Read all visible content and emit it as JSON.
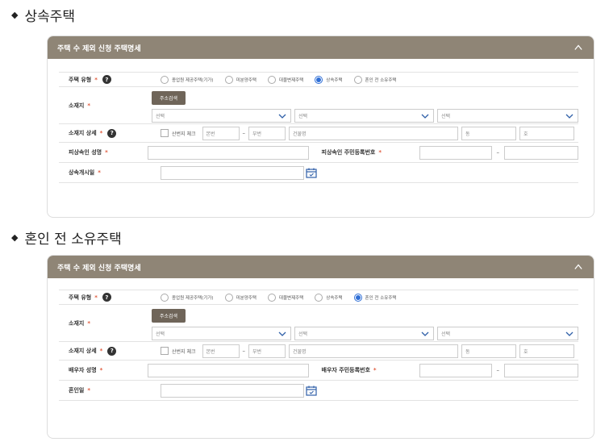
{
  "sections": [
    {
      "title": "상속주택",
      "panel_title": "주택 수 제외 신청 주택명세",
      "housing_type": {
        "label": "주택 유형",
        "options": [
          "종업원 제공주택(기가)",
          "미분양주택",
          "대물변제주택",
          "상속주택",
          "혼인 전 소유주택"
        ],
        "selected": "상속주택"
      },
      "address": {
        "label": "소재지",
        "search_button": "주소검색",
        "selects": [
          "선택",
          "선택",
          "선택"
        ]
      },
      "address_detail": {
        "label": "소재지 상세",
        "checkbox_label": "산번지 체크",
        "main_no": "본번",
        "sub_no": "부번",
        "building": "건물명",
        "dong": "동",
        "ho": "호"
      },
      "person_name": {
        "label": "피상속인 성명"
      },
      "person_id": {
        "label": "피상속인 주민등록번호"
      },
      "date": {
        "label": "상속개시일"
      }
    },
    {
      "title": "혼인 전 소유주택",
      "panel_title": "주택 수 제외 신청 주택명세",
      "housing_type": {
        "label": "주택 유형",
        "options": [
          "종업원 제공주택(기가)",
          "미분양주택",
          "대물변제주택",
          "상속주택",
          "혼인 전 소유주택"
        ],
        "selected": "혼인 전 소유주택"
      },
      "address": {
        "label": "소재지",
        "search_button": "주소검색",
        "selects": [
          "선택",
          "선택",
          "선택"
        ]
      },
      "address_detail": {
        "label": "소재지 상세",
        "checkbox_label": "산번지 체크",
        "main_no": "본번",
        "sub_no": "부번",
        "building": "건물명",
        "dong": "동",
        "ho": "호"
      },
      "person_name": {
        "label": "배우자 성명"
      },
      "person_id": {
        "label": "배우자 주민등록번호"
      },
      "date": {
        "label": "혼인일"
      }
    }
  ],
  "colors": {
    "header": "#8f8576",
    "button": "#6f6559",
    "required": "#e05a3c",
    "radio_on": "#2f6fd6"
  }
}
